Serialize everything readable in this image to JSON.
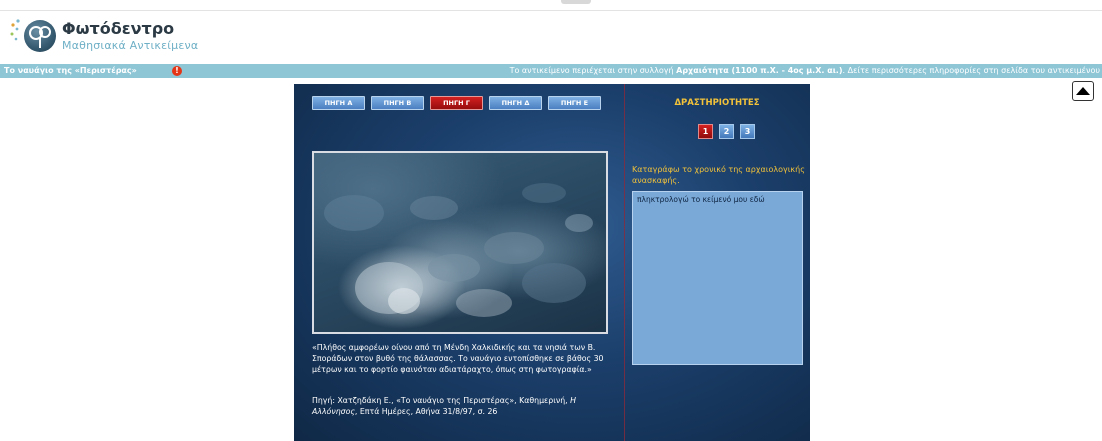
{
  "header": {
    "logo_title": "Φωτόδεντρο",
    "logo_subtitle": "Μαθησιακά Αντικείμενα"
  },
  "infobar": {
    "object_title": "Το ναυάγιο της «Περιστέρας»",
    "alert_icon": "!",
    "collection_prefix": "Το αντικείμενο περιέχεται στην συλλογή ",
    "collection_name": "Αρχαιότητα (1100 π.Χ. - 4ος μ.Χ. αι.)",
    "collection_suffix": ". Δείτε περισσότερες πληροφορίες στη σελίδα του αντικειμένου"
  },
  "activity_panel": {
    "source_tabs": [
      "ΠΗΓΗ Α",
      "ΠΗΓΗ Β",
      "ΠΗΓΗ Γ",
      "ΠΗΓΗ Δ",
      "ΠΗΓΗ Ε"
    ],
    "active_tab_index": 2,
    "caption": "«Πλήθος αμφορέων οίνου από τη Μένδη Χαλκιδικής και τα νησιά των Β. Σποράδων στον βυθό της θάλασσας. Το ναυάγιο εντοπίσθηκε σε βάθος 30 μέτρων και το φορτίο φαινόταν αδιατάραχτο, όπως στη φωτογραφία.»",
    "source_prefix": "Πηγή: Χατζηδάκη Ε., «Το ναυάγιο της Περιστέρας», Καθημερινή, ",
    "source_italic": "Η Αλλόνησος",
    "source_suffix": ", Επτά Ημέρες, Αθήνα 31/8/97, σ. 26",
    "activities_title": "ΔΡΑΣΤΗΡΙΟΤΗΤΕΣ",
    "activity_numbers": [
      "1",
      "2",
      "3"
    ],
    "active_activity_index": 0,
    "prompt": "Καταγράφω το χρονικό της αρχαιολογικής ανασκαφής.",
    "input_placeholder": "πληκτρολογώ το κείμενό μου εδώ"
  },
  "icons": {
    "alert": "exclamation-circle-icon",
    "scroll_top": "arrow-up-icon",
    "logo": "logo-icon"
  },
  "colors": {
    "infobar_bg": "#8ec6d6",
    "active_tab": "#c41a1a",
    "inactive_tab": "#5a8fd0",
    "activity_title": "#f2c23a",
    "panel_bg": "#1b3f6b"
  }
}
